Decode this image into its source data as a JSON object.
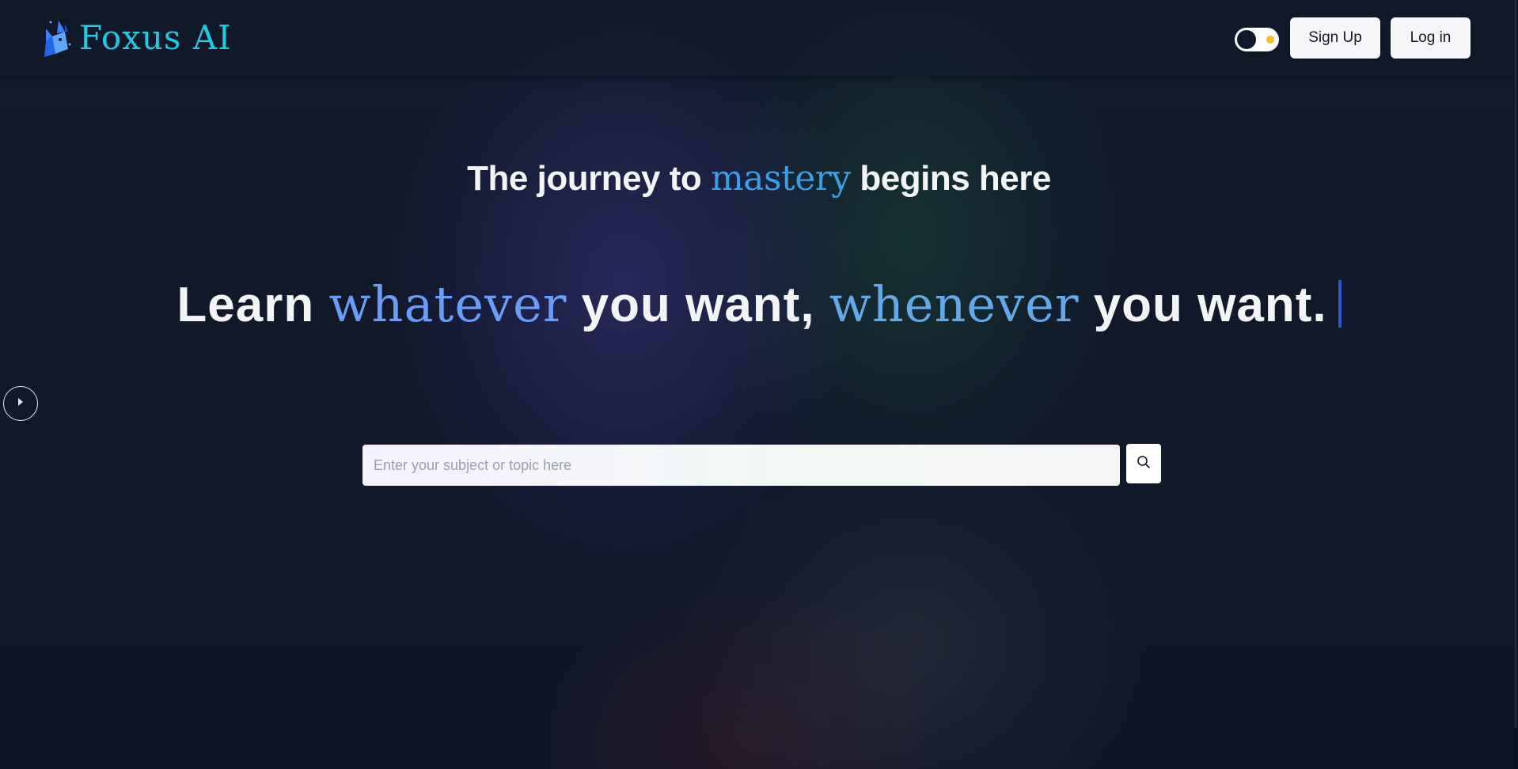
{
  "header": {
    "logo_text": "Foxus AI",
    "logo_icon": "fox-icon",
    "theme_toggle": {
      "state": "dark",
      "icon": "sun-icon"
    },
    "signup_label": "Sign Up",
    "login_label": "Log in"
  },
  "hero": {
    "tagline_before": "The journey to",
    "tagline_accent": "mastery",
    "tagline_after": "begins here",
    "headline": {
      "part1": "Learn",
      "accent1": "whatever",
      "part2": "you want,",
      "accent2": "whenever",
      "part3": "you want."
    }
  },
  "search": {
    "placeholder": "Enter your subject or topic here",
    "value": "",
    "button_icon": "search-icon"
  },
  "sidebar_toggle_icon": "chevron-right-icon",
  "colors": {
    "logo": "#22c9e0",
    "accent_mastery": "#3b9fe8",
    "accent_whatever": "#6a9df5",
    "accent_whenever": "#64a8e8",
    "cursor": "#2f55d4",
    "toggle_sun": "#f5c023",
    "background": "#0f1628"
  }
}
